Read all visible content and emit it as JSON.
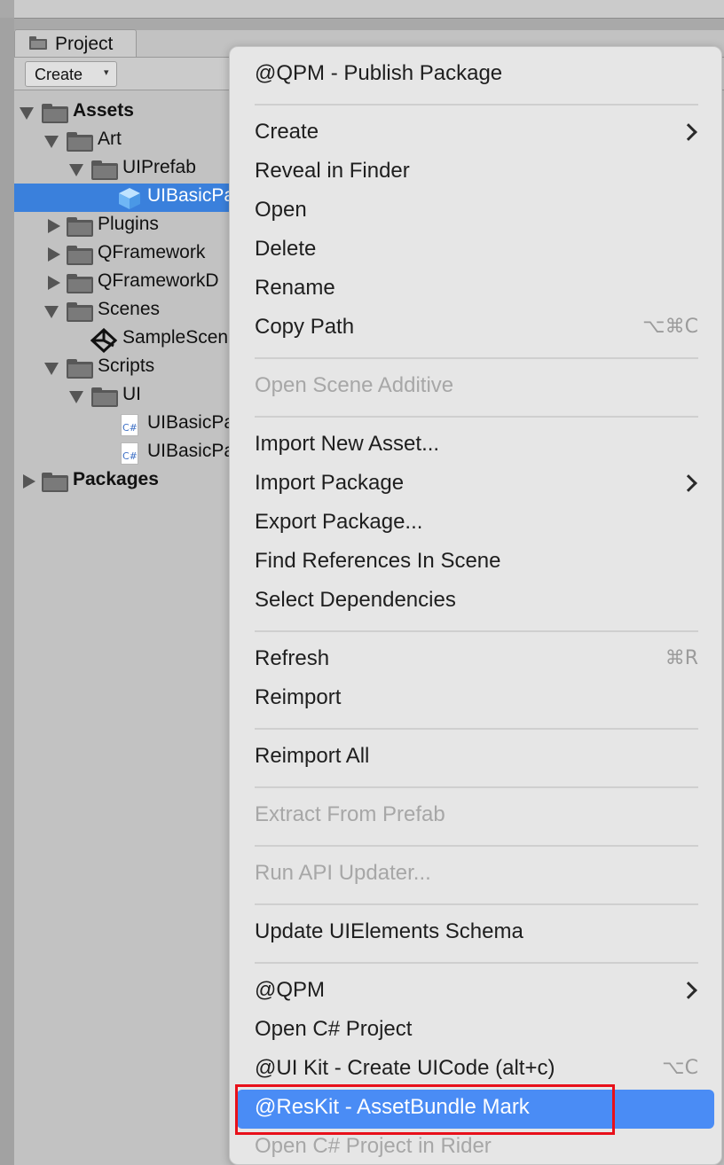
{
  "panel": {
    "tab_label": "Project",
    "create_label": "Create",
    "create_caret": "▾"
  },
  "tree": [
    {
      "label": "Assets",
      "bold": true
    },
    {
      "label": "Art"
    },
    {
      "label": "UIPrefab"
    },
    {
      "label": "UIBasicPa",
      "selected": true
    },
    {
      "label": "Plugins"
    },
    {
      "label": "QFramework"
    },
    {
      "label": "QFrameworkD"
    },
    {
      "label": "Scenes"
    },
    {
      "label": "SampleScen"
    },
    {
      "label": "Scripts"
    },
    {
      "label": "UI"
    },
    {
      "label": "UIBasicPa"
    },
    {
      "label": "UIBasicPa"
    },
    {
      "label": "Packages",
      "bold": true
    }
  ],
  "cs_icon_text": "C#",
  "menu": {
    "items": [
      {
        "label": "@QPM - Publish Package"
      },
      {
        "label": "Create",
        "submenu": true
      },
      {
        "label": "Reveal in Finder"
      },
      {
        "label": "Open"
      },
      {
        "label": "Delete"
      },
      {
        "label": "Rename"
      },
      {
        "label": "Copy Path",
        "shortcut": "⌥⌘C"
      },
      {
        "label": "Open Scene Additive",
        "disabled": true
      },
      {
        "label": "Import New Asset..."
      },
      {
        "label": "Import Package",
        "submenu": true
      },
      {
        "label": "Export Package..."
      },
      {
        "label": "Find References In Scene"
      },
      {
        "label": "Select Dependencies"
      },
      {
        "label": "Refresh",
        "shortcut": "⌘R"
      },
      {
        "label": "Reimport"
      },
      {
        "label": "Reimport All"
      },
      {
        "label": "Extract From Prefab",
        "disabled": true
      },
      {
        "label": "Run API Updater...",
        "disabled": true
      },
      {
        "label": "Update UIElements Schema"
      },
      {
        "label": "@QPM",
        "submenu": true
      },
      {
        "label": "Open C# Project"
      },
      {
        "label": "@UI Kit - Create UICode (alt+c)",
        "shortcut": "⌥C"
      },
      {
        "label": "@ResKit - AssetBundle Mark",
        "highlighted": true
      },
      {
        "label": "Open C# Project in Rider",
        "disabled": true
      }
    ]
  },
  "colors": {
    "selection": "#3a80dc",
    "menu_highlight": "#4a8cf5",
    "annotation_box": "#e8101a"
  }
}
